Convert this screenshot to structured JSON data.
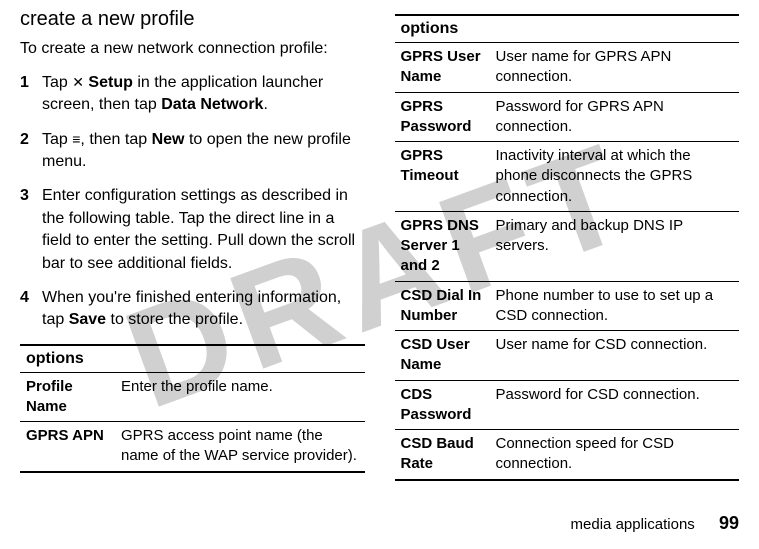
{
  "watermark": "DRAFT",
  "heading": "create a new profile",
  "intro": "To create a new network connection profile:",
  "steps": {
    "s1_num": "1",
    "s1_a": "Tap ",
    "s1_setup_icon": "✕",
    "s1_b": " Setup",
    "s1_c": " in the application launcher screen, then tap ",
    "s1_d": "Data Network",
    "s1_e": ".",
    "s2_num": "2",
    "s2_a": "Tap ",
    "s2_menu_icon": "≡",
    "s2_b": ", then tap ",
    "s2_c": "New",
    "s2_d": " to open the new profile menu.",
    "s3_num": "3",
    "s3_text": "Enter configuration settings as described in the following table. Tap the direct line in a field to enter the setting. Pull down the scroll bar to see additional fields.",
    "s4_num": "4",
    "s4_a": "When you're finished entering information, tap ",
    "s4_b": "Save",
    "s4_c": " to store the profile."
  },
  "table1": {
    "header": "options",
    "r1a": "Profile Name",
    "r1b": "Enter the profile name.",
    "r2a": "GPRS APN",
    "r2b": "GPRS access point name (the name of the WAP service provider)."
  },
  "table2": {
    "header": "options",
    "r1a": "GPRS User Name",
    "r1b": "User name for GPRS APN connection.",
    "r2a": "GPRS Password",
    "r2b": "Password for GPRS APN connection.",
    "r3a": "GPRS Timeout",
    "r3b": "Inactivity interval at which the phone disconnects the GPRS connection.",
    "r4a": "GPRS DNS Server 1 and 2",
    "r4b": "Primary and backup DNS IP servers.",
    "r5a": "CSD Dial In Number",
    "r5b": "Phone number to use to set up a CSD connection.",
    "r6a": "CSD User Name",
    "r6b": "User name for CSD connection.",
    "r7a": "CDS Password",
    "r7b": "Password for CSD connection.",
    "r8a": "CSD Baud Rate",
    "r8b": "Connection speed for CSD connection."
  },
  "footer": {
    "section": "media applications",
    "page": "99"
  }
}
